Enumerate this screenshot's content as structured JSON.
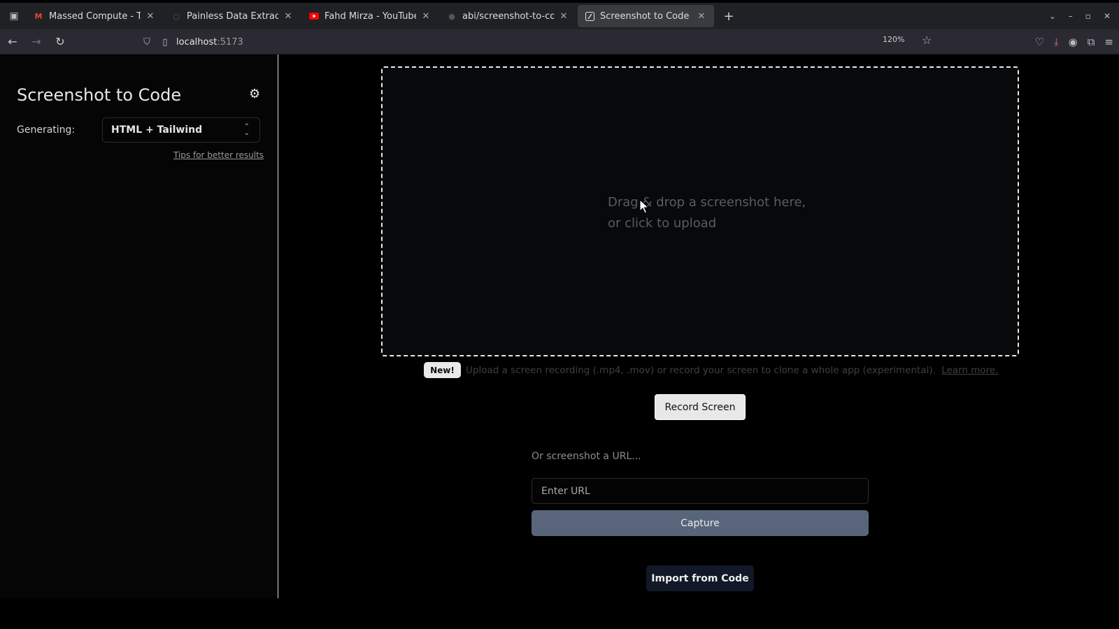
{
  "browser": {
    "tabs": [
      {
        "title": "Massed Compute - Think",
        "favicon": "gmail-icon",
        "favicon_color": "#ea4335",
        "active": false
      },
      {
        "title": "Painless Data Extraction",
        "favicon": "globe-icon",
        "favicon_color": "#999999",
        "active": false
      },
      {
        "title": "Fahd Mirza - YouTube",
        "favicon": "youtube-icon",
        "favicon_color": "#ff0000",
        "active": false
      },
      {
        "title": "abi/screenshot-to-code: D",
        "favicon": "github-icon",
        "favicon_color": "#cccccc",
        "active": false
      },
      {
        "title": "Screenshot to Code",
        "favicon": "code-icon",
        "favicon_color": "#dddddd",
        "active": true
      }
    ],
    "url": {
      "host": "localhost",
      "port": ":5173"
    },
    "zoom": "120%"
  },
  "sidebar": {
    "title": "Screenshot to Code",
    "generating_label": "Generating:",
    "stack_selected": "HTML + Tailwind",
    "tips_link": "Tips for better results"
  },
  "dropzone": {
    "line1": "Drag & drop a screenshot here,",
    "line2": "or click to upload"
  },
  "recording": {
    "badge": "New!",
    "text": "Upload a screen recording (.mp4, .mov) or record your screen to clone a whole app (experimental).",
    "learn_more": "Learn more.",
    "record_button": "Record Screen"
  },
  "url_capture": {
    "label": "Or screenshot a URL...",
    "placeholder": "Enter URL",
    "capture_button": "Capture"
  },
  "import_button": "Import from Code",
  "colors": {
    "capture_button": "#58657a",
    "import_button": "#111827",
    "background": "#000000"
  }
}
